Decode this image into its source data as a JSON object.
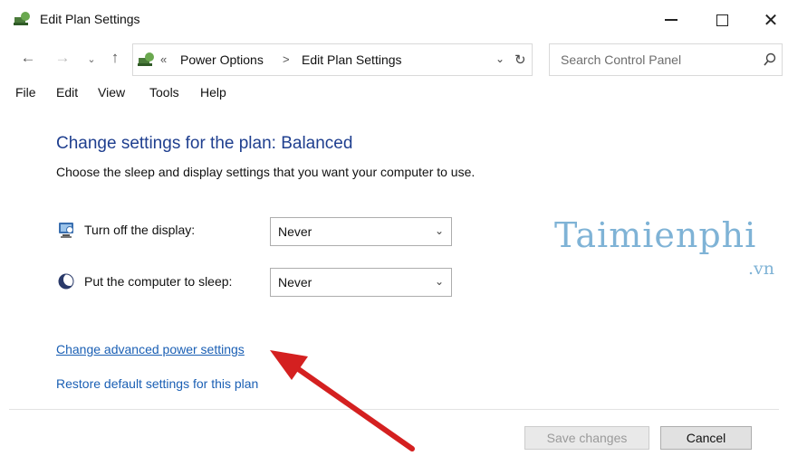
{
  "window": {
    "title": "Edit Plan Settings"
  },
  "nav": {
    "breadcrumb_prefix": "«",
    "crumbs": [
      "Power Options",
      "Edit Plan Settings"
    ],
    "crumb_separator": ">",
    "search_placeholder": "Search Control Panel"
  },
  "menu": {
    "items": [
      "File",
      "Edit",
      "View",
      "Tools",
      "Help"
    ]
  },
  "main": {
    "heading": "Change settings for the plan: Balanced",
    "subtext": "Choose the sleep and display settings that you want your computer to use.",
    "settings": [
      {
        "label": "Turn off the display:",
        "value": "Never",
        "icon": "monitor-icon"
      },
      {
        "label": "Put the computer to sleep:",
        "value": "Never",
        "icon": "moon-icon"
      }
    ],
    "links": {
      "advanced": "Change advanced power settings",
      "restore": "Restore default settings for this plan"
    }
  },
  "watermark": {
    "brand": "Taimienphi",
    "tld": ".vn"
  },
  "buttons": {
    "save": "Save changes",
    "cancel": "Cancel"
  },
  "colors": {
    "heading": "#1f3f8f",
    "link": "#1a5fb4",
    "annotation_arrow": "#d42020",
    "watermark": "#7fb3d6"
  }
}
